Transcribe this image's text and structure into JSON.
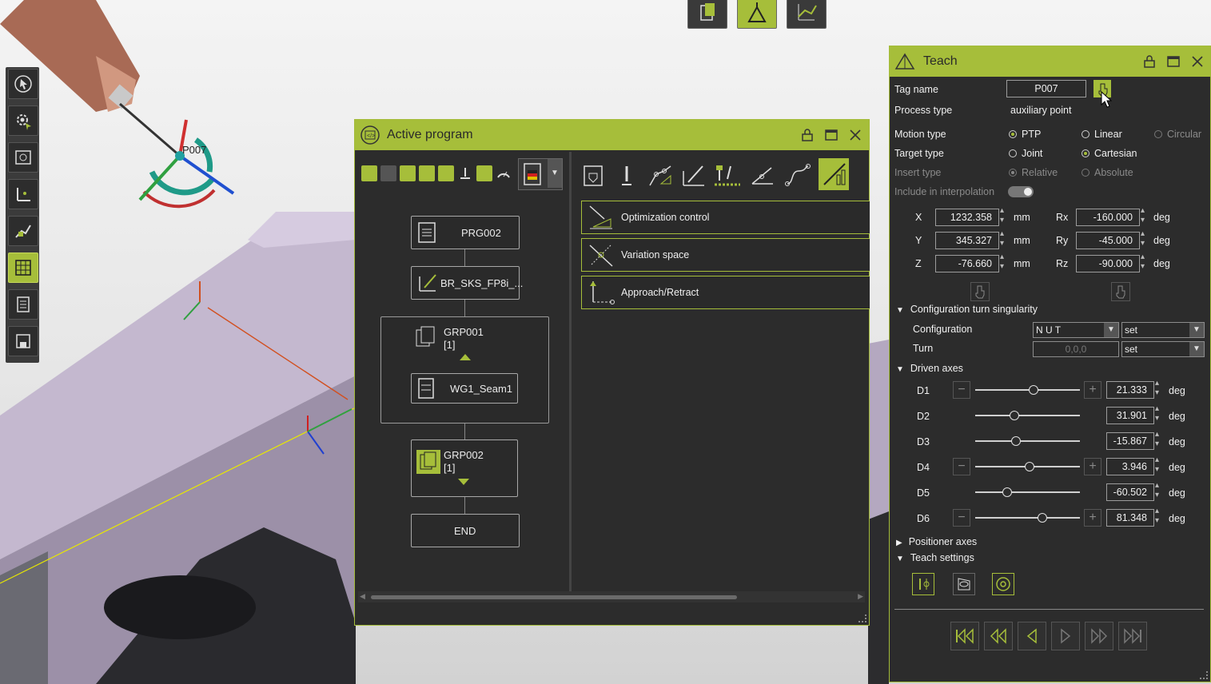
{
  "scene": {
    "point_tag": "P007"
  },
  "left_toolbar": [
    {
      "icon": "cursor-select-icon"
    },
    {
      "icon": "settings-gear-icon"
    },
    {
      "icon": "map-view-icon"
    },
    {
      "icon": "frame-axes-icon"
    },
    {
      "icon": "path-edit-icon"
    },
    {
      "icon": "calendar-grid-icon",
      "active": true
    },
    {
      "icon": "document-list-icon"
    },
    {
      "icon": "save-disk-icon"
    }
  ],
  "top_toolbar": [
    {
      "icon": "clipboard-copy-icon"
    },
    {
      "icon": "robot-torch-icon",
      "active": true
    },
    {
      "icon": "grid-chart-icon"
    }
  ],
  "active_program": {
    "title": "Active program",
    "tree": {
      "program": "PRG002",
      "seam_node": "BR_SKS_FP8i_...",
      "group1": {
        "name": "GRP001",
        "count": "[1]"
      },
      "seam": "WG1_Seam1",
      "group2": {
        "name": "GRP002",
        "count": "[1]"
      },
      "end": "END"
    },
    "list": [
      {
        "label": "Optimization control",
        "icon": "optimization-icon"
      },
      {
        "label": "Variation space",
        "icon": "variation-space-icon"
      },
      {
        "label": "Approach/Retract",
        "icon": "approach-retract-icon"
      }
    ]
  },
  "teach": {
    "title": "Teach",
    "tag_name_label": "Tag name",
    "tag_name_value": "P007",
    "process_type_label": "Process type",
    "process_type_value": "auxiliary point",
    "motion_type_label": "Motion type",
    "motion_options": [
      "PTP",
      "Linear",
      "Circular"
    ],
    "motion_selected": "PTP",
    "target_type_label": "Target type",
    "target_options": [
      "Joint",
      "Cartesian"
    ],
    "target_selected": "Cartesian",
    "insert_type_label": "Insert type",
    "insert_options": [
      "Relative",
      "Absolute"
    ],
    "insert_selected": "Relative",
    "interp_label": "Include in interpolation",
    "interp_on": true,
    "coords": {
      "X": {
        "value": "1232.358",
        "unit": "mm"
      },
      "Y": {
        "value": "345.327",
        "unit": "mm"
      },
      "Z": {
        "value": "-76.660",
        "unit": "mm"
      },
      "Rx": {
        "value": "-160.000",
        "unit": "deg"
      },
      "Ry": {
        "value": "-45.000",
        "unit": "deg"
      },
      "Rz": {
        "value": "-90.000",
        "unit": "deg"
      }
    },
    "config_section": "Configuration turn singularity",
    "configuration_label": "Configuration",
    "configuration_value": "N U T",
    "configuration_mode": "set",
    "turn_label": "Turn",
    "turn_value": "0,0,0",
    "turn_mode": "set",
    "driven_section": "Driven axes",
    "axes": [
      {
        "name": "D1",
        "value": "21.333",
        "unit": "deg",
        "pos": 0.55,
        "pm": true
      },
      {
        "name": "D2",
        "value": "31.901",
        "unit": "deg",
        "pos": 0.37,
        "pm": false
      },
      {
        "name": "D3",
        "value": "-15.867",
        "unit": "deg",
        "pos": 0.38,
        "pm": false
      },
      {
        "name": "D4",
        "value": "3.946",
        "unit": "deg",
        "pos": 0.51,
        "pm": true
      },
      {
        "name": "D5",
        "value": "-60.502",
        "unit": "deg",
        "pos": 0.3,
        "pm": false
      },
      {
        "name": "D6",
        "value": "81.348",
        "unit": "deg",
        "pos": 0.63,
        "pm": true
      }
    ],
    "positioner_section": "Positioner axes",
    "teach_settings_section": "Teach settings"
  },
  "colors": {
    "accent": "#a6be3a",
    "panel": "#2c2c2c",
    "part": "#b9acc4"
  }
}
